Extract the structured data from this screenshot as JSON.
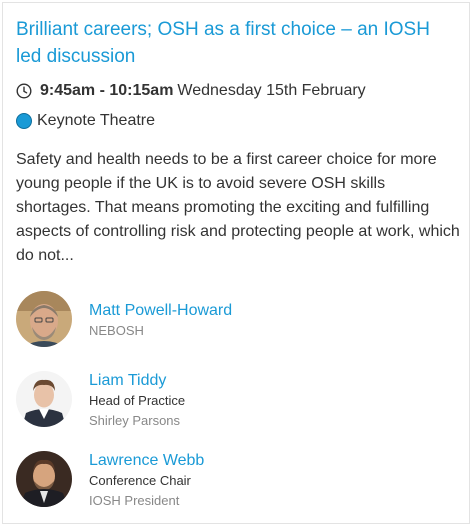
{
  "session": {
    "title": "Brilliant careers; OSH as a first choice – an IOSH led discussion",
    "time": "9:45am - 10:15am",
    "date": "Wednesday 15th February",
    "location": "Keynote Theatre",
    "description": "Safety and health needs to be a first career choice for more young people if the UK is to avoid severe OSH skills shortages. That means promoting the exciting and fulfilling aspects of controlling risk and protecting people at work, which do not..."
  },
  "speakers": [
    {
      "name": "Matt Powell-Howard",
      "role": "",
      "org": "NEBOSH"
    },
    {
      "name": "Liam Tiddy",
      "role": "Head of Practice",
      "org": "Shirley Parsons"
    },
    {
      "name": "Lawrence Webb",
      "role": "Conference Chair",
      "org": "IOSH President"
    }
  ],
  "icons": {
    "time": "clock-icon",
    "location": "location-dot-icon"
  },
  "colors": {
    "accent": "#1a9ad6",
    "text": "#333333",
    "muted": "#888888"
  }
}
